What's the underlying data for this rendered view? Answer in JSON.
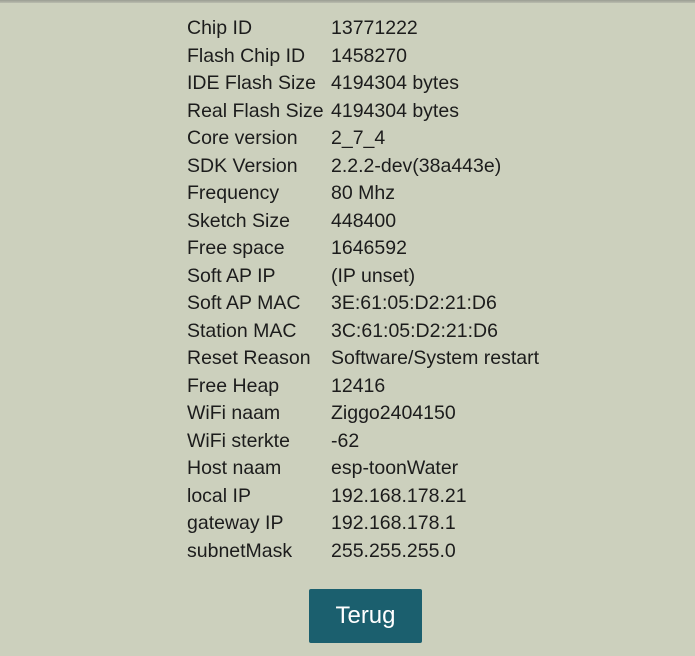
{
  "device_info": {
    "rows": [
      {
        "label": "Chip ID",
        "value": "13771222"
      },
      {
        "label": "Flash Chip ID",
        "value": "1458270"
      },
      {
        "label": "IDE Flash Size",
        "value": "4194304 bytes"
      },
      {
        "label": "Real Flash Size",
        "value": "4194304 bytes"
      },
      {
        "label": "Core version",
        "value": "2_7_4"
      },
      {
        "label": "SDK Version",
        "value": "2.2.2-dev(38a443e)"
      },
      {
        "label": "Frequency",
        "value": "80 Mhz"
      },
      {
        "label": "Sketch Size",
        "value": "448400"
      },
      {
        "label": "Free space",
        "value": "1646592"
      },
      {
        "label": "Soft AP IP",
        "value": "(IP unset)"
      },
      {
        "label": "Soft AP MAC",
        "value": "3E:61:05:D2:21:D6"
      },
      {
        "label": "Station MAC",
        "value": "3C:61:05:D2:21:D6"
      },
      {
        "label": "Reset Reason",
        "value": "Software/System restart"
      },
      {
        "label": "Free Heap",
        "value": "12416"
      },
      {
        "label": "WiFi naam",
        "value": "Ziggo2404150"
      },
      {
        "label": "WiFi sterkte",
        "value": "-62"
      },
      {
        "label": "Host naam",
        "value": "esp-toonWater"
      },
      {
        "label": "local IP",
        "value": "192.168.178.21"
      },
      {
        "label": "gateway IP",
        "value": "192.168.178.1"
      },
      {
        "label": "subnetMask",
        "value": "255.255.255.0"
      }
    ]
  },
  "back_button": {
    "label": "Terug"
  },
  "colors": {
    "background": "#ccd0bd",
    "button": "#1b5f6e",
    "button_text": "#ffffff",
    "text": "#1c1c1c"
  }
}
